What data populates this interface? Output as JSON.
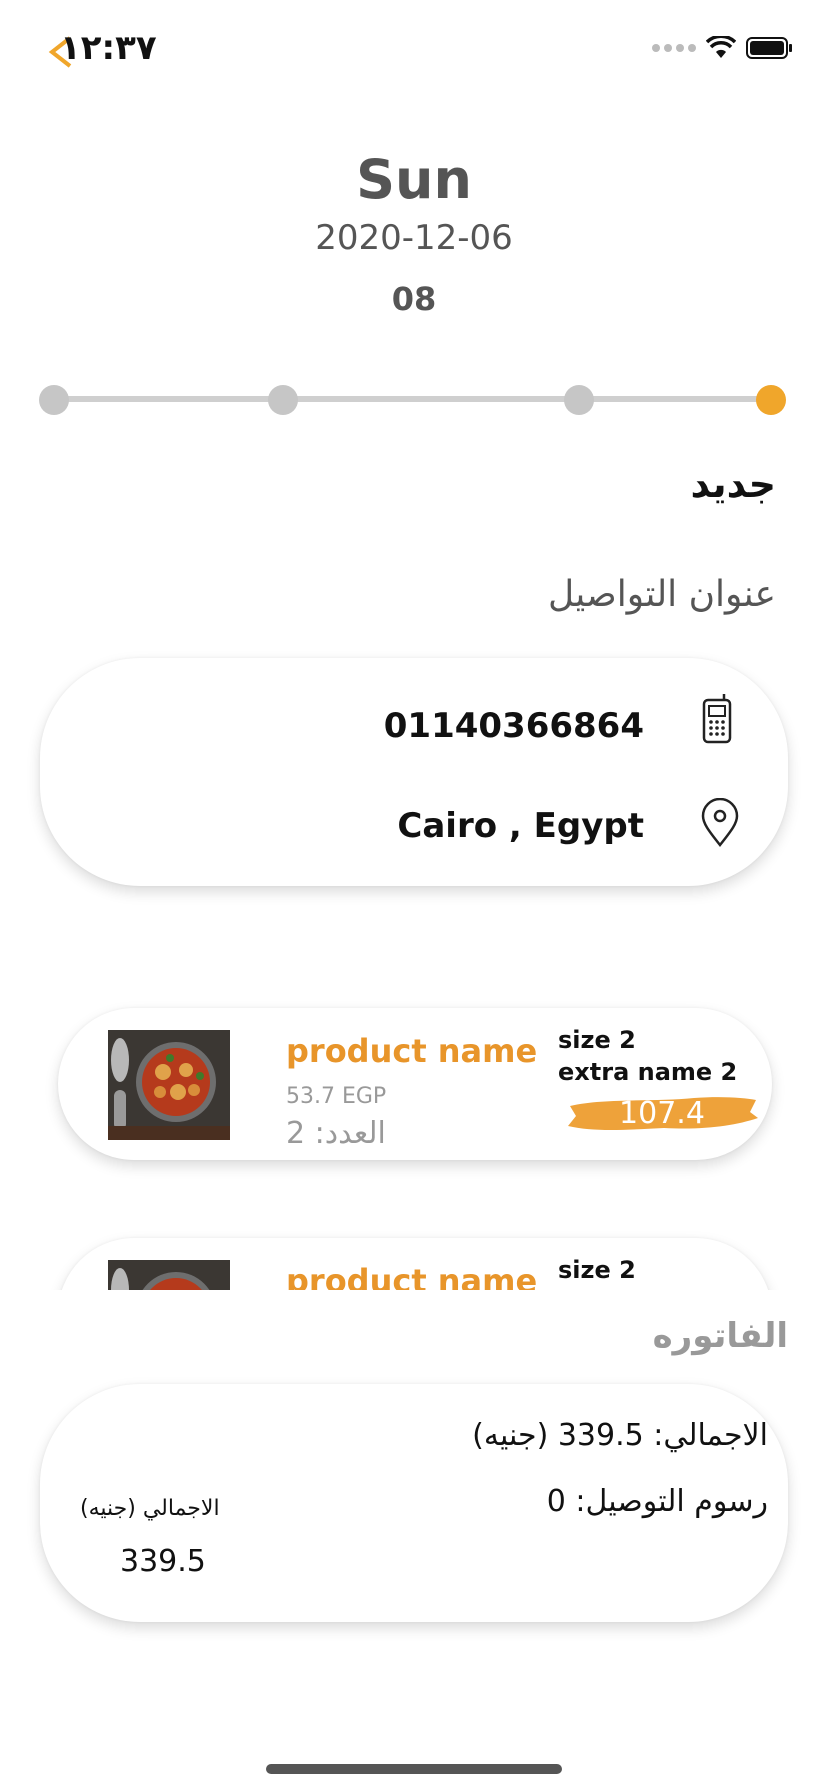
{
  "status_bar": {
    "time": "١٢:٣٧"
  },
  "header": {
    "day": "Sun",
    "date": "2020-12-06",
    "hour": "08"
  },
  "progress": {
    "steps": 4,
    "active_step": 4,
    "accent_color": "#f0a62b"
  },
  "order_status": "جديد",
  "contact": {
    "section_title": "عنوان التواصيل",
    "phone": "01140366864",
    "address": "Cairo , Egypt",
    "phone_icon": "mobile-phone-icon",
    "address_icon": "location-pin-icon"
  },
  "products": [
    {
      "name": "product name",
      "unit_price": "53.7 EGP",
      "quantity_label": "العدد: 2",
      "size": "size 2",
      "extra": "extra name 2",
      "total": "107.4"
    },
    {
      "name": "product name",
      "size": "size 2"
    }
  ],
  "invoice": {
    "title": "الفاتوره",
    "total_line": "الاجمالي: 339.5 (جنيه)",
    "delivery_line": "رسوم التوصيل: 0",
    "side_label": "الاجمالي (جنيه)",
    "side_value": "339.5"
  }
}
